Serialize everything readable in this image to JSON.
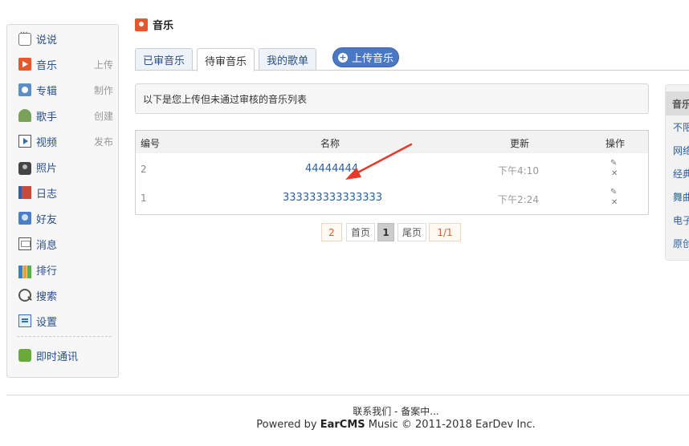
{
  "sidebar": {
    "items": [
      {
        "label": "说说",
        "action": ""
      },
      {
        "label": "音乐",
        "action": "上传"
      },
      {
        "label": "专辑",
        "action": "制作"
      },
      {
        "label": "歌手",
        "action": "创建"
      },
      {
        "label": "视频",
        "action": "发布"
      },
      {
        "label": "照片",
        "action": ""
      },
      {
        "label": "日志",
        "action": ""
      },
      {
        "label": "好友",
        "action": ""
      },
      {
        "label": "消息",
        "action": ""
      },
      {
        "label": "排行",
        "action": ""
      },
      {
        "label": "搜索",
        "action": ""
      },
      {
        "label": "设置",
        "action": ""
      },
      {
        "label": "即时通讯",
        "action": ""
      }
    ]
  },
  "page": {
    "title": "音乐"
  },
  "tabs": [
    {
      "label": "已审音乐"
    },
    {
      "label": "待审音乐"
    },
    {
      "label": "我的歌单"
    }
  ],
  "upload_button": {
    "label": "上传音乐"
  },
  "notice": {
    "text": "以下是您上传但未通过审核的音乐列表"
  },
  "table": {
    "headers": {
      "id": "编号",
      "name": "名称",
      "updated": "更新",
      "ops": "操作"
    },
    "rows": [
      {
        "id": "2",
        "name": "44444444",
        "updated": "下午4:10"
      },
      {
        "id": "1",
        "name": "333333333333333",
        "updated": "下午2:24"
      }
    ]
  },
  "pager": {
    "total": "2",
    "first": "首页",
    "current": "1",
    "last": "尾页",
    "info": "1/1"
  },
  "right_panel": {
    "head": "音乐",
    "items": [
      "不限",
      "网络",
      "经典",
      "舞曲",
      "电子",
      "原创"
    ]
  },
  "footer": {
    "line1": "联系我们 - 备案中...",
    "line2_prefix": "Powered by ",
    "line2_brand": "EarCMS",
    "line2_suffix": " Music © 2011-2018 EarDev Inc."
  },
  "colors": {
    "accent": "#e8562a",
    "link": "#2a5fa0",
    "button": "#4a78c4",
    "annotation": "#e8392c"
  },
  "icons": [
    "chat-bubble-icon",
    "music-icon",
    "album-icon",
    "singer-icon",
    "video-icon",
    "camera-icon",
    "diary-icon",
    "friends-icon",
    "message-icon",
    "ranking-icon",
    "search-icon",
    "settings-icon",
    "instant-chat-icon",
    "edit-icon",
    "delete-icon"
  ]
}
